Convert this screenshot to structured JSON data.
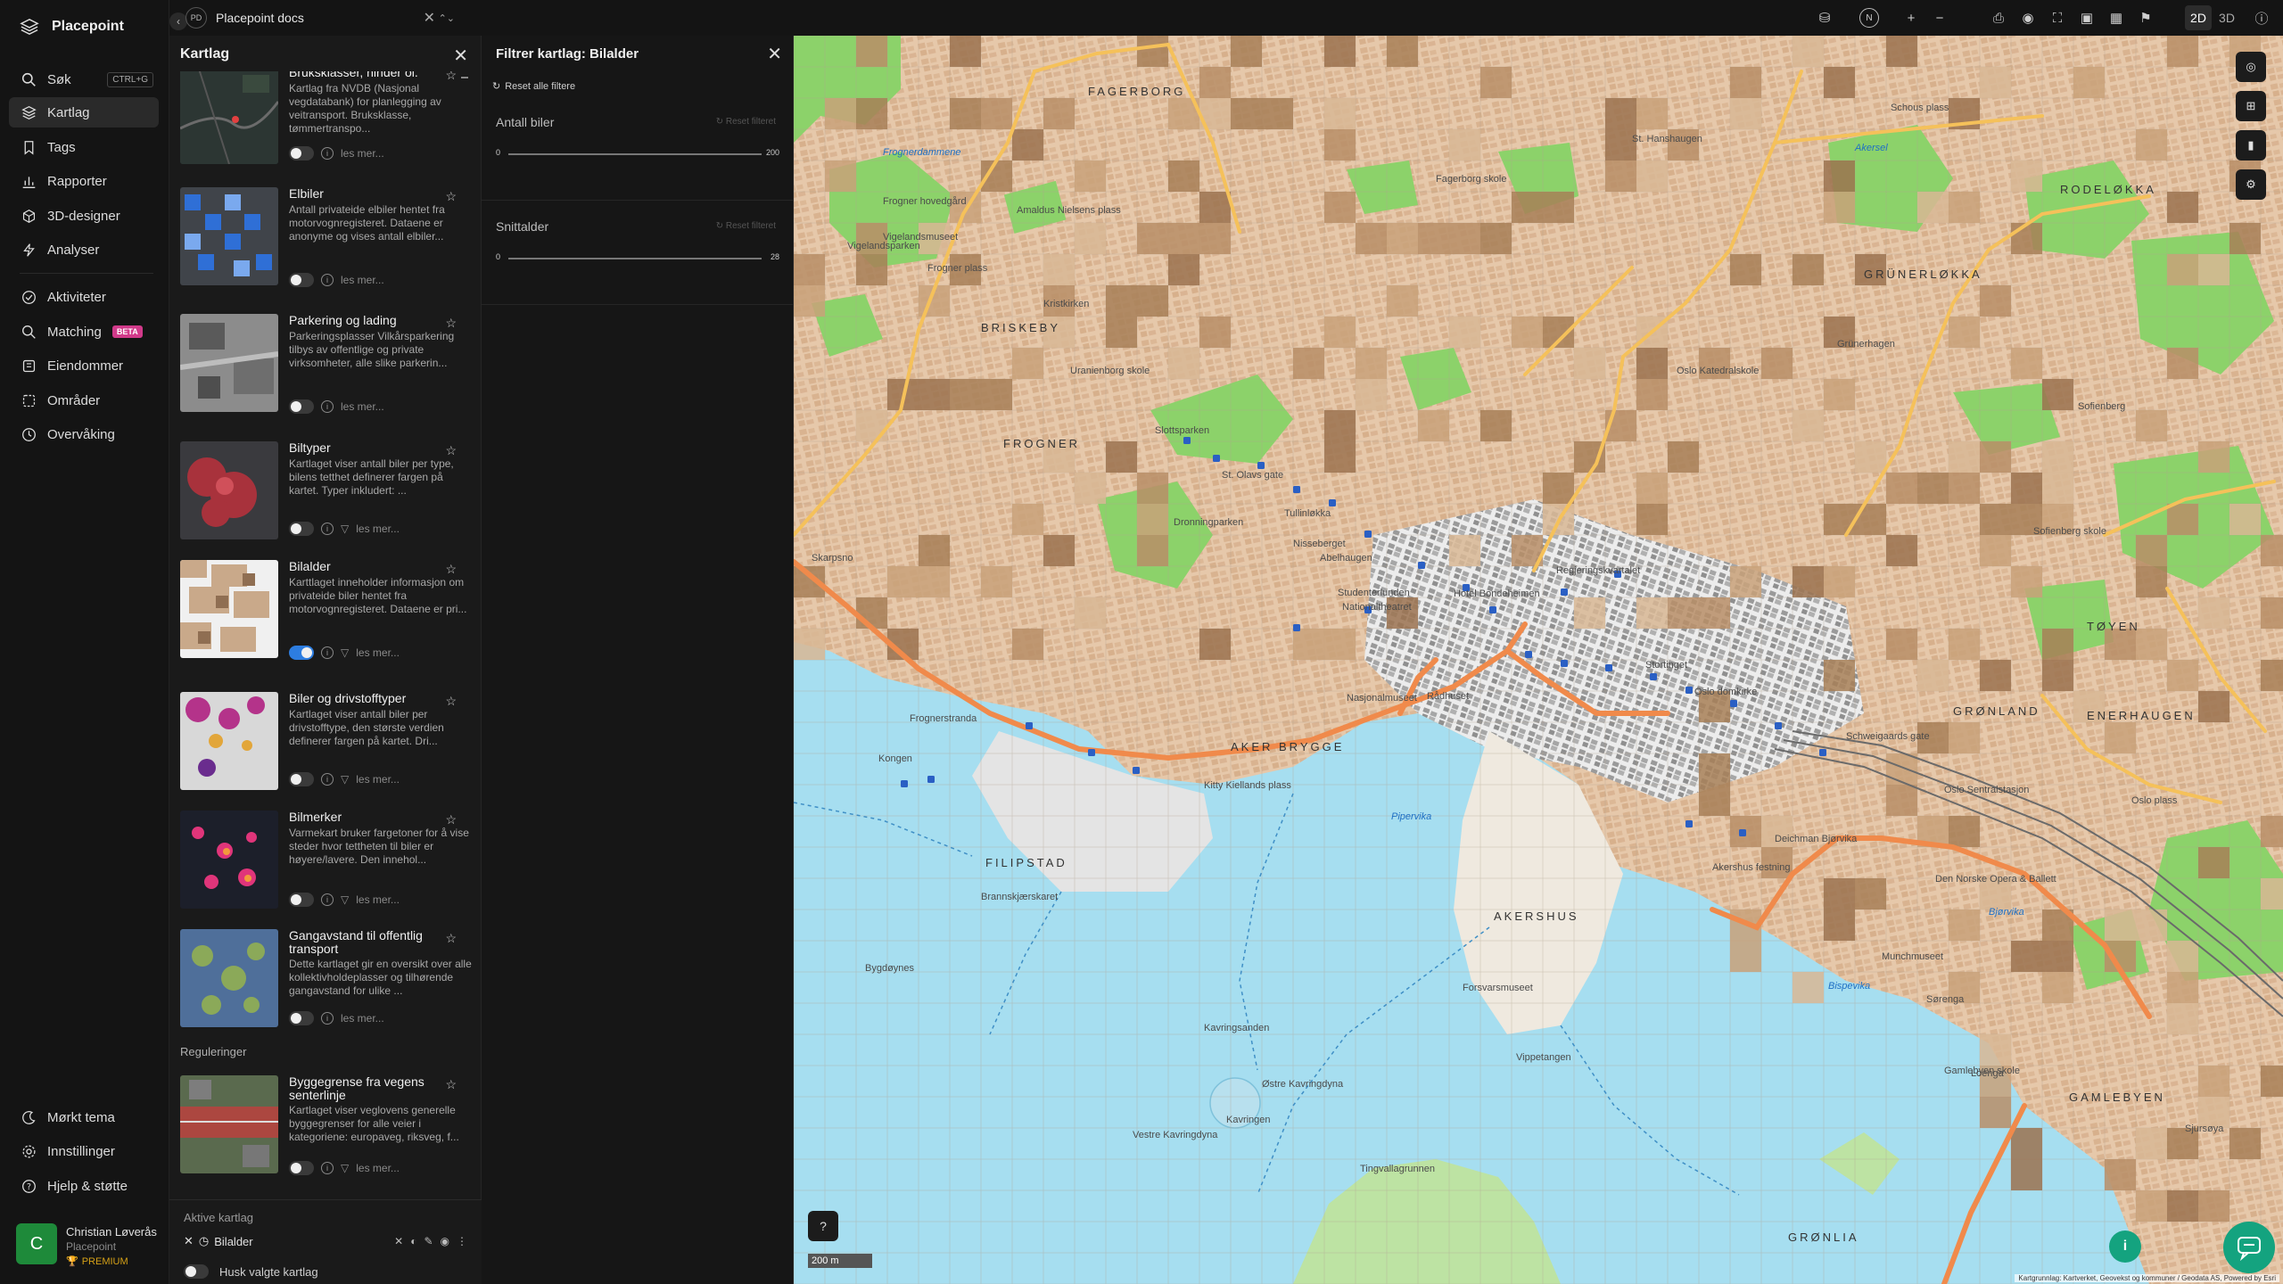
{
  "app": {
    "name": "Placepoint"
  },
  "nav": {
    "items": [
      {
        "label": "Søk",
        "shortcut": "CTRL+G"
      },
      {
        "label": "Kartlag"
      },
      {
        "label": "Tags"
      },
      {
        "label": "Rapporter"
      },
      {
        "label": "3D-designer"
      },
      {
        "label": "Analyser"
      }
    ],
    "items2": [
      {
        "label": "Aktiviteter"
      },
      {
        "label": "Matching",
        "badge": "BETA"
      },
      {
        "label": "Eiendommer"
      },
      {
        "label": "Områder"
      },
      {
        "label": "Overvåking"
      }
    ],
    "bottom": [
      {
        "label": "Mørkt tema"
      },
      {
        "label": "Innstillinger"
      },
      {
        "label": "Hjelp & støtte"
      }
    ],
    "user": {
      "initial": "C",
      "name": "Christian Løverås",
      "org": "Placepoint",
      "tier": "PREMIUM"
    }
  },
  "doc": {
    "badge": "PD",
    "name": "Placepoint docs"
  },
  "layers_panel": {
    "title": "Kartlag",
    "more_label": "les mer...",
    "layers": [
      {
        "title": "Bruksklasser, hinder ol.",
        "desc": "Kartlag fra NVDB (Nasjonal vegdatabank) for planlegging av veitransport. Bruksklasse, tømmertranspo..."
      },
      {
        "title": "Elbiler",
        "desc": "Antall privateide elbiler hentet fra motorvognregisteret. Dataene er anonyme og vises antall elbiler..."
      },
      {
        "title": "Parkering og lading",
        "desc": "Parkeringsplasser Vilkårsparkering tilbys av offentlige og private virksomheter, alle slike parkerin..."
      },
      {
        "title": "Biltyper",
        "desc": "Kartlaget viser antall biler per type, bilens tetthet definerer fargen på kartet. Typer inkludert: ..."
      },
      {
        "title": "Bilalder",
        "desc": "Karttlaget inneholder informasjon om privateide biler hentet fra motorvognregisteret. Dataene er pri..."
      },
      {
        "title": "Biler og drivstofftyper",
        "desc": "Kartlaget viser antall biler per drivstofftype, den største verdien definerer fargen på kartet. Dri..."
      },
      {
        "title": "Bilmerker",
        "desc": "Varmekart bruker fargetoner for å vise steder hvor tettheten til biler er høyere/lavere. Den innehol..."
      },
      {
        "title": "Gangavstand til offentlig transport",
        "desc": "Dette kartlaget gir en oversikt over alle kollektivholdeplasser og tilhørende gangavstand for ulike ..."
      },
      {
        "title": "Byggegrense fra vegens senterlinje",
        "desc": "Kartlaget viser veglovens generelle byggegrenser for alle veier i kategoriene: europaveg, riksveg, f..."
      }
    ],
    "section_reguleringer": "Reguleringer",
    "active_title": "Aktive kartlag",
    "active_layer": "Bilalder",
    "remember_label": "Husk valgte kartlag"
  },
  "filter_panel": {
    "title": "Filtrer kartlag: Bilalder",
    "reset_all": "Reset alle filtere",
    "reset_filter": "Reset filteret",
    "filters": [
      {
        "label": "Antall biler",
        "min": "0",
        "max": "200"
      },
      {
        "label": "Snittalder",
        "min": "0",
        "max": "28"
      }
    ]
  },
  "toolbar": {
    "north": "N",
    "mode_2d": "2D",
    "mode_3d": "3D"
  },
  "map": {
    "scale": "200 m",
    "attribution": "Kartgrunnlag: Kartverket, Geovekst og kommuner / Geodata AS, Powered by Esri",
    "districts": [
      "FAGERBORG",
      "BRISKEBY",
      "FROGNER",
      "GRÜNERLØKKA",
      "RODELØKKA",
      "TØYEN",
      "GRØNLAND",
      "ENERHAUGEN",
      "AKER BRYGGE",
      "FILIPSTAD",
      "AKERSHUS",
      "GAMLEBYEN",
      "GRØNLIA"
    ],
    "places": [
      "Vigelandsmuseet",
      "Frognerdammene",
      "Frogner hovedgård",
      "Vigelandsparken",
      "Frogner plass",
      "Amaldus Nielsens plass",
      "Uranienborg skole",
      "Slottsparken",
      "Dronningparken",
      "St. Olavs gate",
      "Nisseberget",
      "Abelhaugen",
      "Nationaltheatret",
      "Studenterlunden",
      "Hotel Bondeheimen",
      "Regjeringskvartalet",
      "Akersel",
      "Sofienberg",
      "Schweigaards gate",
      "Oslo Sentralstasjon",
      "Den Norske Opera & Ballett",
      "Bjørvika",
      "Akershus festning",
      "Rådhuset",
      "Nasjonalmuseet",
      "Kitty Kiellands plass",
      "Kongen",
      "Bygdøynes",
      "Kavringsanden",
      "Kavringen",
      "Østre Kavringdyna",
      "Vestre Kavringdyna",
      "Tingvallagrunnen",
      "Munchmuseet",
      "Sørenga",
      "Loenga",
      "Gamlebyen skole",
      "Vippetangen",
      "Forsvarsmuseet",
      "Pipervika",
      "Brannskjærskaret",
      "Frognerstranda",
      "Skarpsno",
      "Sofienberg skole",
      "Kristkirken",
      "Grünerhagen",
      "Fagerborg skole",
      "St. Hanshaugen",
      "Schous plass",
      "Tullinløkka",
      "Oslo domkirke",
      "Stortinget",
      "Deichman Bjørvika",
      "Bispevika",
      "Oslo plass",
      "Sjursøya",
      "Oslo Katedralskole"
    ],
    "water": [
      "Frognerdammene",
      "Pipervika",
      "Bjørvika",
      "Akerselva",
      "Bispevika",
      "Akersel"
    ]
  },
  "colors": {
    "accent": "#2d7de0",
    "brand_green": "#14a37f",
    "premium": "#d4a017",
    "beta": "#d13a8a"
  }
}
